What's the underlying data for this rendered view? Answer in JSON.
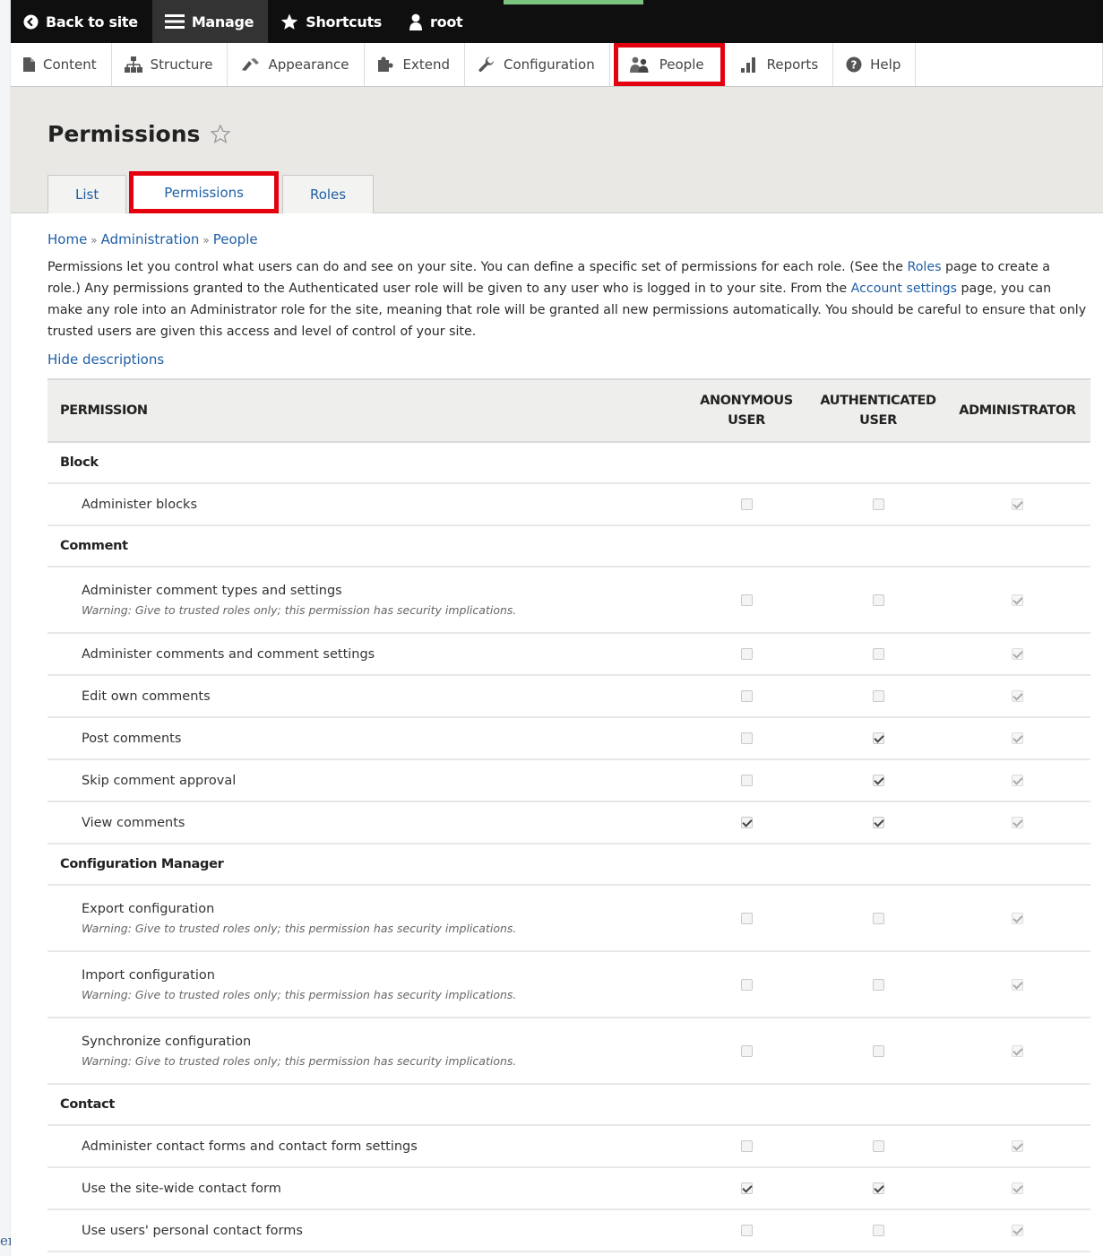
{
  "edge_fragment": "er",
  "toolbar": {
    "back_label": "Back to site",
    "manage_label": "Manage",
    "shortcuts_label": "Shortcuts",
    "user_label": "root"
  },
  "tray": [
    {
      "label": "Content",
      "icon": "content-icon"
    },
    {
      "label": "Structure",
      "icon": "structure-icon"
    },
    {
      "label": "Appearance",
      "icon": "appearance-icon"
    },
    {
      "label": "Extend",
      "icon": "extend-icon"
    },
    {
      "label": "Configuration",
      "icon": "configuration-icon"
    },
    {
      "label": "People",
      "icon": "people-icon"
    },
    {
      "label": "Reports",
      "icon": "reports-icon"
    },
    {
      "label": "Help",
      "icon": "help-icon"
    }
  ],
  "page": {
    "title": "Permissions"
  },
  "tabs": [
    "List",
    "Permissions",
    "Roles"
  ],
  "breadcrumb": [
    "Home",
    "Administration",
    "People"
  ],
  "description": {
    "p1": "Permissions let you control what users can do and see on your site. You can define a specific set of permissions for each role. (See the ",
    "link_roles": "Roles",
    "p2": " page to create a role.) Any permissions granted to the Authenticated user role will be given to any user who is logged in to your site. From the ",
    "link_account": "Account settings",
    "p3": " page, you can make any role into an Administrator role for the site, meaning that role will be granted all new permissions automatically. You should be careful to ensure that only trusted users are given this access and level of control of your site."
  },
  "hide_descriptions": "Hide descriptions",
  "table": {
    "headers": {
      "permission": "PERMISSION",
      "anon_1": "ANONYMOUS",
      "anon_2": "USER",
      "auth_1": "AUTHENTICATED",
      "auth_2": "USER",
      "admin": "ADMINISTRATOR"
    },
    "warning_text": "Warning: Give to trusted roles only; this permission has security implications.",
    "rows": [
      {
        "type": "module",
        "label": "Block"
      },
      {
        "type": "perm",
        "label": "Administer blocks",
        "anon": false,
        "auth": false,
        "admin": true,
        "warning": false
      },
      {
        "type": "module",
        "label": "Comment"
      },
      {
        "type": "perm",
        "label": "Administer comment types and settings",
        "anon": false,
        "auth": false,
        "admin": true,
        "warning": true
      },
      {
        "type": "perm",
        "label": "Administer comments and comment settings",
        "anon": false,
        "auth": false,
        "admin": true,
        "warning": false
      },
      {
        "type": "perm",
        "label": "Edit own comments",
        "anon": false,
        "auth": false,
        "admin": true,
        "warning": false
      },
      {
        "type": "perm",
        "label": "Post comments",
        "anon": false,
        "auth": true,
        "admin": true,
        "warning": false
      },
      {
        "type": "perm",
        "label": "Skip comment approval",
        "anon": false,
        "auth": true,
        "admin": true,
        "warning": false
      },
      {
        "type": "perm",
        "label": "View comments",
        "anon": true,
        "auth": true,
        "admin": true,
        "warning": false
      },
      {
        "type": "module",
        "label": "Configuration Manager"
      },
      {
        "type": "perm",
        "label": "Export configuration",
        "anon": false,
        "auth": false,
        "admin": true,
        "warning": true
      },
      {
        "type": "perm",
        "label": "Import configuration",
        "anon": false,
        "auth": false,
        "admin": true,
        "warning": true
      },
      {
        "type": "perm",
        "label": "Synchronize configuration",
        "anon": false,
        "auth": false,
        "admin": true,
        "warning": true
      },
      {
        "type": "module",
        "label": "Contact"
      },
      {
        "type": "perm",
        "label": "Administer contact forms and contact form settings",
        "anon": false,
        "auth": false,
        "admin": true,
        "warning": false
      },
      {
        "type": "perm",
        "label": "Use the site-wide contact form",
        "anon": true,
        "auth": true,
        "admin": true,
        "warning": false
      },
      {
        "type": "perm",
        "label": "Use users' personal contact forms",
        "anon": false,
        "auth": false,
        "admin": true,
        "warning": false
      }
    ]
  }
}
